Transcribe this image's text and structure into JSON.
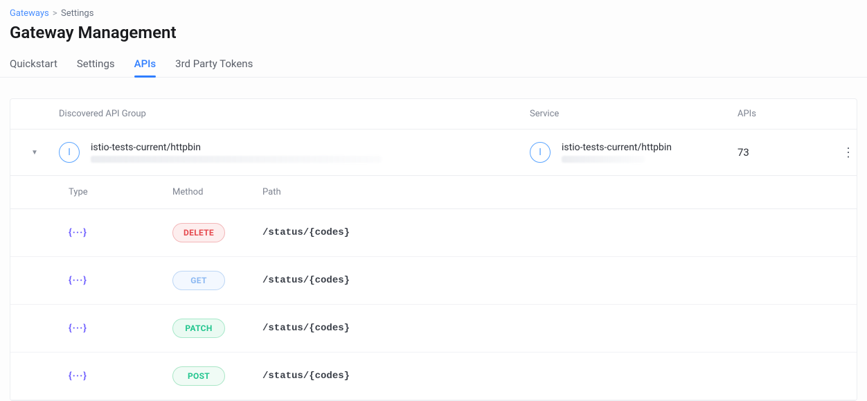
{
  "breadcrumb": {
    "root": "Gateways",
    "current": "Settings"
  },
  "page_title": "Gateway Management",
  "tabs": {
    "quickstart": "Quickstart",
    "settings": "Settings",
    "apis": "APIs",
    "tokens": "3rd Party Tokens"
  },
  "columns": {
    "group": "Discovered API Group",
    "service": "Service",
    "apis": "APIs"
  },
  "group": {
    "icon_letter": "I",
    "name": "istio-tests-current/httpbin",
    "service_icon_letter": "I",
    "service_name": "istio-tests-current/httpbin",
    "api_count": "73"
  },
  "subcolumns": {
    "type": "Type",
    "method": "Method",
    "path": "Path"
  },
  "type_glyph": "{···}",
  "apis": [
    {
      "method": "DELETE",
      "method_class": "m-delete",
      "path": "/status/{codes}"
    },
    {
      "method": "GET",
      "method_class": "m-get",
      "path": "/status/{codes}"
    },
    {
      "method": "PATCH",
      "method_class": "m-patch",
      "path": "/status/{codes}"
    },
    {
      "method": "POST",
      "method_class": "m-post",
      "path": "/status/{codes}"
    }
  ]
}
